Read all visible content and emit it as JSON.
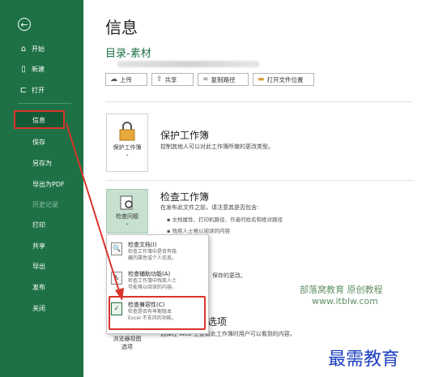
{
  "sidebar": {
    "back_label": "←",
    "items": [
      {
        "label": "开始",
        "icon": "home-icon"
      },
      {
        "label": "新建",
        "icon": "new-file-icon"
      },
      {
        "label": "打开",
        "icon": "open-folder-icon"
      },
      {
        "label": "信息",
        "icon": ""
      },
      {
        "label": "保存",
        "icon": ""
      },
      {
        "label": "另存为",
        "icon": ""
      },
      {
        "label": "导出为PDF",
        "icon": ""
      },
      {
        "label": "历史记录",
        "icon": ""
      },
      {
        "label": "打印",
        "icon": ""
      },
      {
        "label": "共享",
        "icon": ""
      },
      {
        "label": "导出",
        "icon": ""
      },
      {
        "label": "发布",
        "icon": ""
      },
      {
        "label": "关闭",
        "icon": ""
      }
    ],
    "active": "信息",
    "accent_color": "#1e7145",
    "highlight_color": "#d9342b"
  },
  "main": {
    "title": "信息",
    "breadcrumb": "目录-素材",
    "buttons": [
      {
        "label": "上传",
        "icon": "cloud-upload-icon"
      },
      {
        "label": "共享",
        "icon": "share-icon"
      },
      {
        "label": "复制路径",
        "icon": "link-icon"
      },
      {
        "label": "打开文件位置",
        "icon": "folder-icon"
      }
    ],
    "protect": {
      "button_label": "保护工作簿",
      "title": "保护工作簿",
      "desc": "控制其他人可以对此工作簿所做的更改类型。"
    },
    "inspect": {
      "button_label": "检查问题",
      "title": "检查工作簿",
      "desc": "在发布此文件之前，请注意其是否包含:",
      "bullets": [
        "文档属性、打印机路径、作者的姓名和绝对路径",
        "残疾人士难以阅读的内容"
      ],
      "partial_text": "保存的更改。"
    },
    "browser": {
      "button_label1": "浏览器视图",
      "button_label2": "选项",
      "title_partial": "选项",
      "desc": "选择在 Web 上查看此工作簿时用户可以看到的内容。"
    }
  },
  "dropdown": {
    "items": [
      {
        "title": "检查文档(I)",
        "desc1": "检查工作簿中是否有隐",
        "desc2": "藏的属性或个人信息。",
        "icon": "inspect-document-icon"
      },
      {
        "title": "检查辅助功能(A)",
        "desc1": "检查工作簿中残疾人士",
        "desc2": "可能难以阅读的内容。",
        "icon": "accessibility-icon"
      },
      {
        "title": "检查兼容性(C)",
        "desc1": "检查是否有早期版本",
        "desc2": "Excel 不支持的功能。",
        "icon": "compatibility-icon"
      }
    ],
    "highlighted": "检查兼容性(C)"
  },
  "watermark": {
    "line1": "部落窝教育   原创教程",
    "line2": "www.itblw.com",
    "corner": "最需教育"
  }
}
